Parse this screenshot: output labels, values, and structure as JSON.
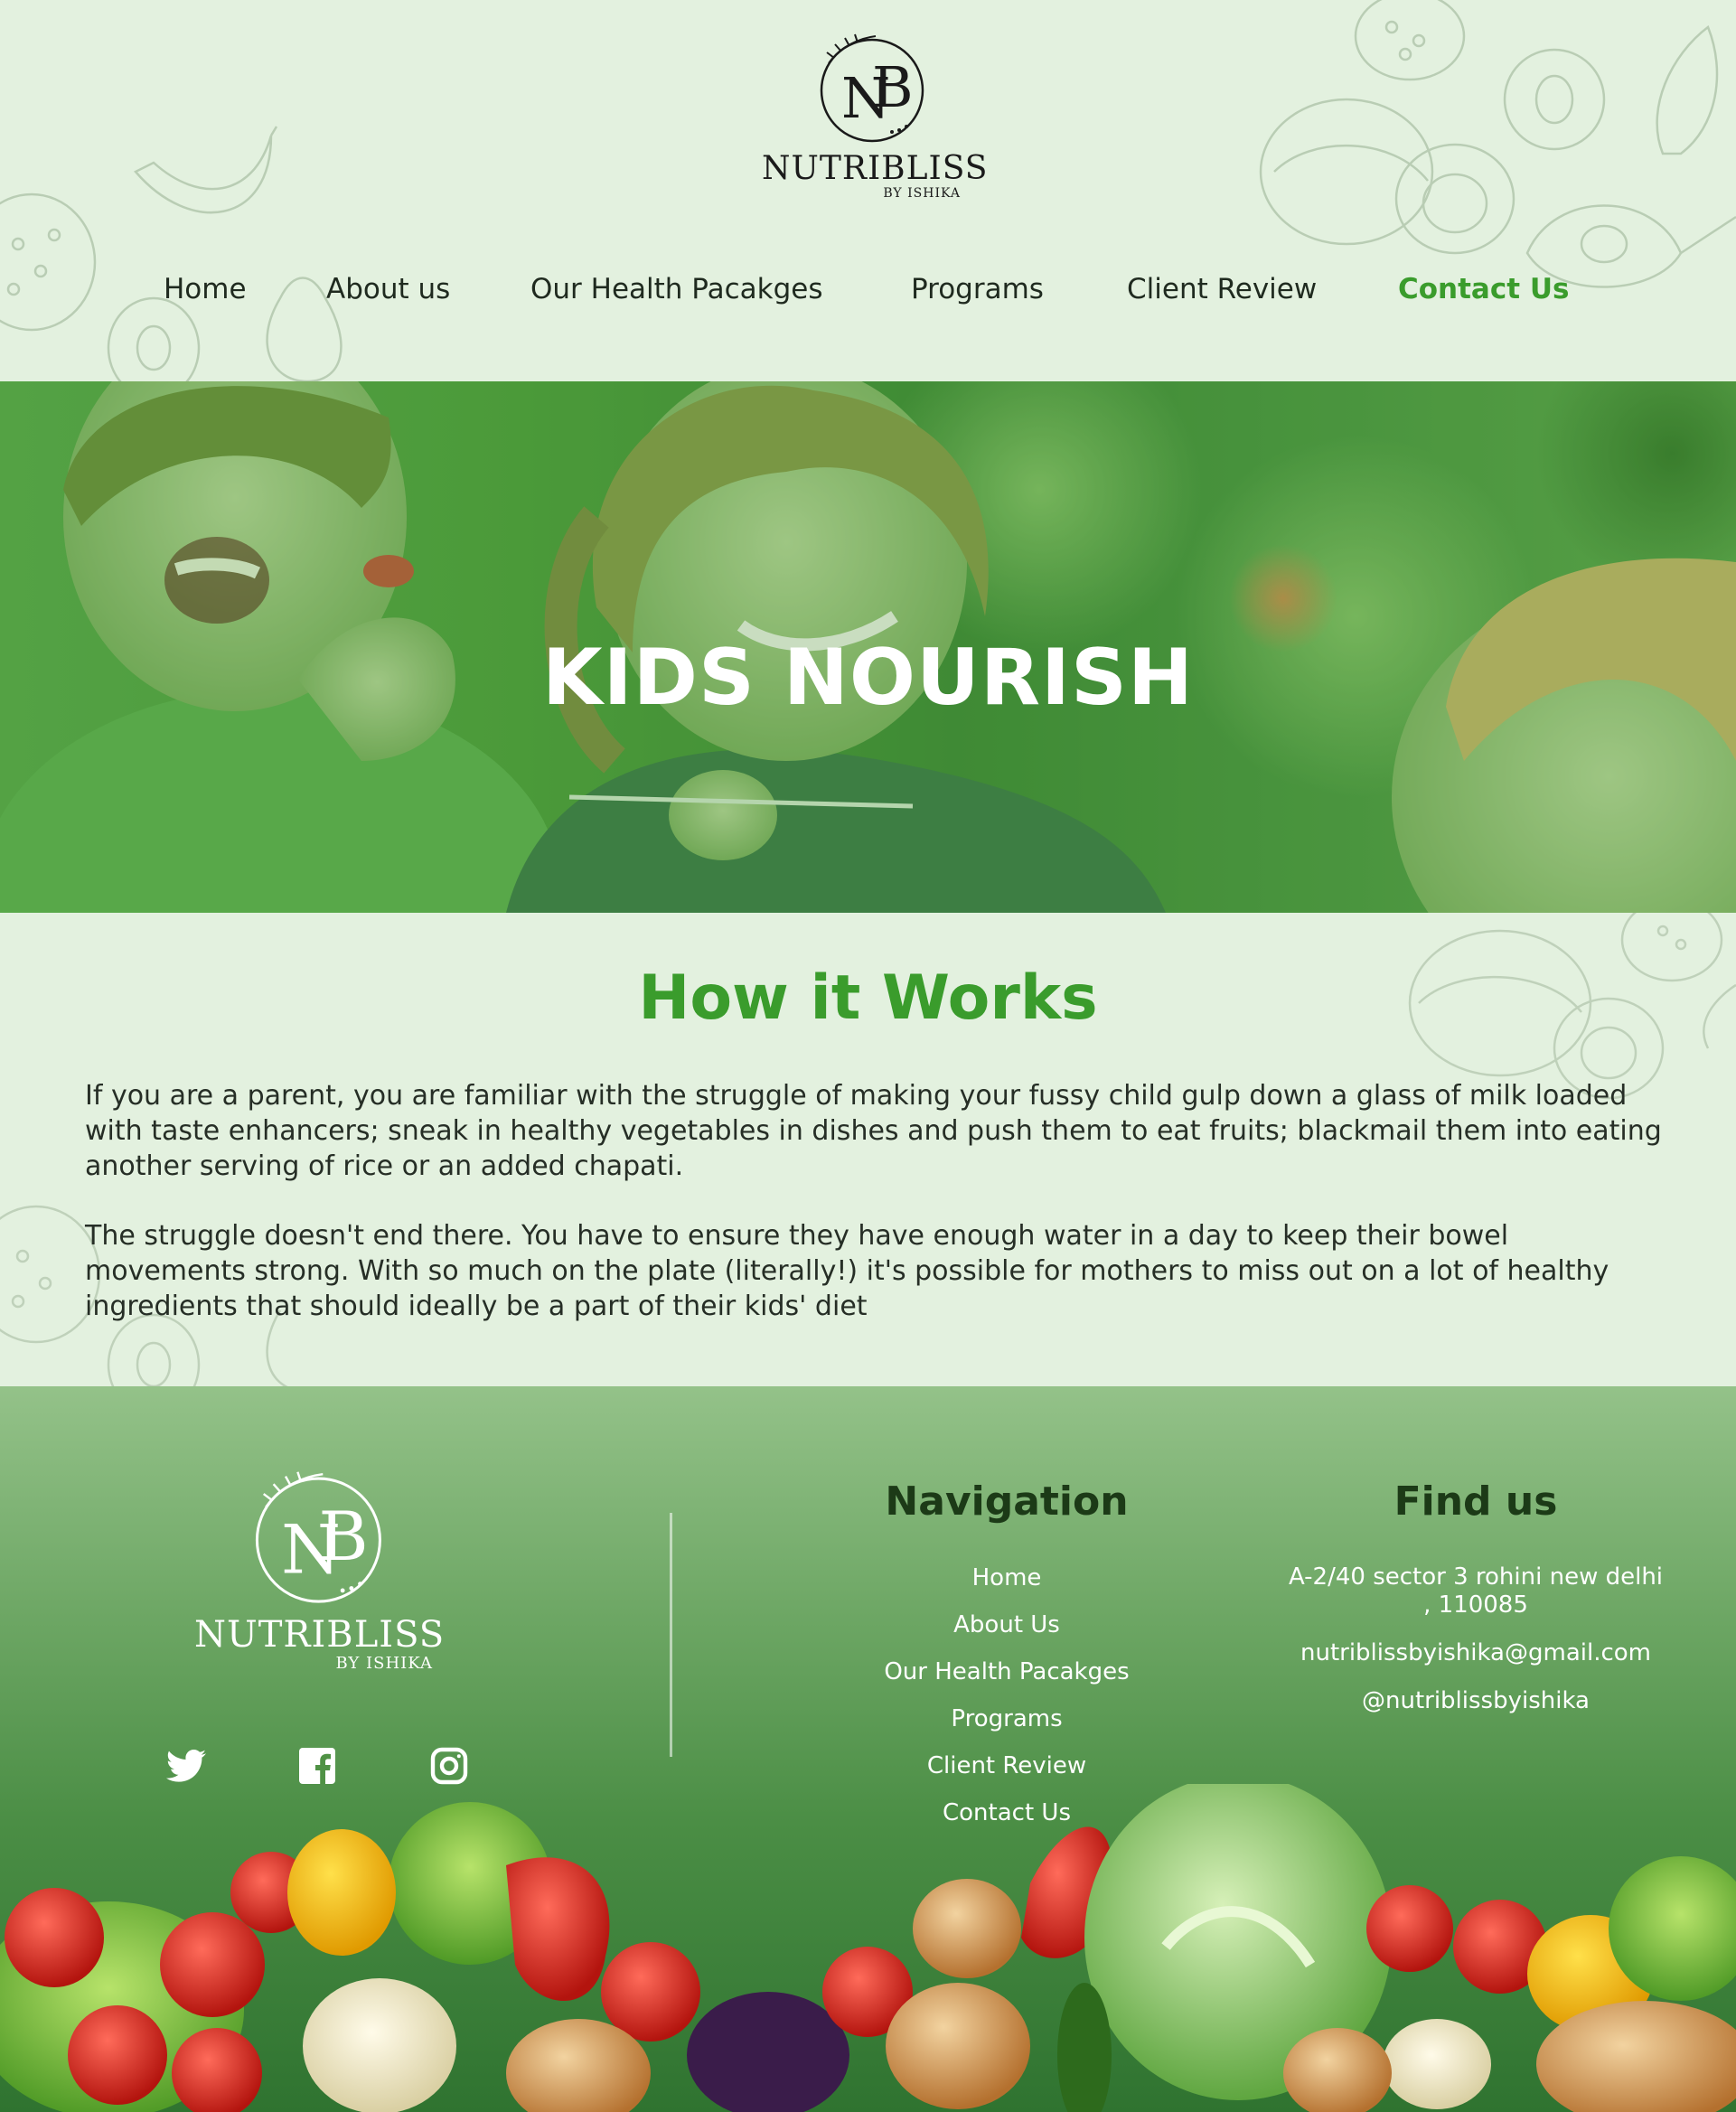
{
  "brand": {
    "monogram": "NB",
    "name": "NUTRIBLISS",
    "sub": "BY ISHIKA",
    "tag": "NUTRIBLISS"
  },
  "nav": {
    "items": [
      "Home",
      "About us",
      "Our Health Pacakges",
      "Programs",
      "Client Review",
      "Contact Us"
    ],
    "active": "Contact Us",
    "active_color": "#3a9c2c"
  },
  "hero": {
    "title": "KIDS NOURISH"
  },
  "works": {
    "title": "How it Works",
    "paragraphs": [
      "If you are a parent, you are familiar with the struggle of making your fussy child gulp down a glass of milk loaded with taste enhancers; sneak in healthy vegetables in dishes and push them to eat fruits; blackmail them into eating another serving of rice or an added chapati.",
      "The struggle doesn't end there. You have to ensure they have enough water in a day to keep their bowel movements strong. With so much on the plate (literally!) it's possible for mothers to miss out on a lot of healthy ingredients that should ideally be a part of their kids' diet"
    ]
  },
  "footer": {
    "social": [
      "twitter-icon",
      "facebook-icon",
      "instagram-icon"
    ],
    "navigation": {
      "title": "Navigation",
      "items": [
        "Home",
        "About Us",
        "Our Health Pacakges",
        "Programs",
        "Client Review",
        "Contact Us"
      ]
    },
    "find": {
      "title": "Find us",
      "address": "A-2/40 sector 3 rohini new delhi , 110085",
      "email": "nutriblissbyishika@gmail.com",
      "handle": "@nutriblissbyishika"
    }
  },
  "colors": {
    "background": "#e3f1df",
    "accent": "#3a9c2c",
    "footer_top": "#94c289",
    "footer_bottom": "#2f7330"
  }
}
